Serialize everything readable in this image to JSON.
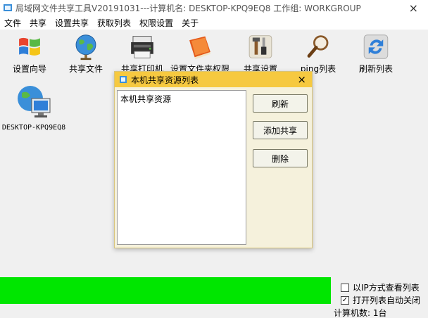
{
  "window": {
    "title": "局域网文件共享工具V20191031---计算机名: DESKTOP-KPQ9EQ8 工作组: WORKGROUP",
    "close_glyph": "×"
  },
  "menu": {
    "items": [
      "文件",
      "共享",
      "设置共享",
      "获取列表",
      "权限设置",
      "关于"
    ]
  },
  "toolbar": {
    "items": [
      {
        "label": "设置向导",
        "icon": "windows-flag-icon"
      },
      {
        "label": "共享文件",
        "icon": "globe-icon"
      },
      {
        "label": "共享打印机",
        "icon": "printer-icon"
      },
      {
        "label": "设置文件夹权限",
        "icon": "folder-book-icon"
      },
      {
        "label": "共享设置",
        "icon": "tools-icon"
      },
      {
        "label": "ping列表",
        "icon": "magnifier-icon"
      },
      {
        "label": "刷新列表",
        "icon": "refresh-icon"
      }
    ]
  },
  "computers": [
    {
      "name": "DESKTOP-KPQ9EQ8",
      "icon": "network-computer-icon"
    }
  ],
  "dialog": {
    "title": "本机共享资源列表",
    "close_glyph": "×",
    "list_items": [
      "本机共享资源"
    ],
    "buttons": {
      "refresh": "刷新",
      "add_share": "添加共享",
      "delete": "删除"
    }
  },
  "progress": {
    "value": 1.0,
    "color": "#00e600"
  },
  "options": {
    "ip_view": {
      "label": "以IP方式查看列表",
      "checked": false
    },
    "auto_close": {
      "label": "打开列表自动关闭",
      "checked": true,
      "check_glyph": "✓"
    }
  },
  "status": {
    "count_text": "计算机数: 1台"
  },
  "colors": {
    "dialog_title_bg": "#f6c940",
    "dialog_bg": "#f5f1dc"
  }
}
